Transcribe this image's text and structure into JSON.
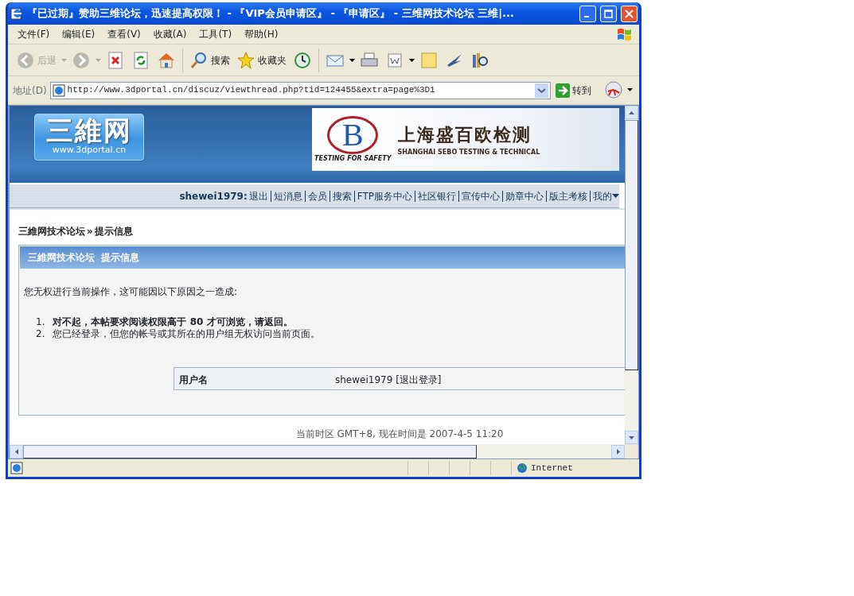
{
  "window": {
    "title": "『已过期』赞助三维论坛，迅速提高权限！ - 『VIP会员申请区』 - 『申请区』 - 三维网技术论坛 三维|..."
  },
  "menu": [
    "文件(F)",
    "编辑(E)",
    "查看(V)",
    "收藏(A)",
    "工具(T)",
    "帮助(H)"
  ],
  "toolbar": [
    {
      "kind": "back",
      "label": "后退",
      "disabled": true,
      "dropdown": true
    },
    {
      "kind": "forward",
      "disabled": true,
      "dropdown": true
    },
    {
      "kind": "stop"
    },
    {
      "kind": "refresh"
    },
    {
      "kind": "home"
    },
    {
      "kind": "search",
      "label": "搜索"
    },
    {
      "kind": "favorites",
      "label": "收藏夹"
    },
    {
      "kind": "history"
    },
    {
      "kind": "mail",
      "dropdown": true
    },
    {
      "kind": "print"
    },
    {
      "kind": "edit",
      "dropdown": true
    },
    {
      "kind": "note"
    },
    {
      "kind": "messenger"
    },
    {
      "kind": "research"
    }
  ],
  "address": {
    "label": "地址(D)",
    "url": "http://www.3dportal.cn/discuz/viewthread.php?tid=124455&extra=page%3D1",
    "go": "转到"
  },
  "page": {
    "logo": {
      "title": "三維网",
      "subtitle": "www.3dportal.cn"
    },
    "banner": {
      "letter": "B",
      "tagline": "TESTING FOR SAFETY",
      "title": "上海盛百欧检测",
      "subtitle": "SHANGHAI SEBO TESTING & TECHNICAL"
    },
    "user_nav": {
      "username": "shewei1979:",
      "links": [
        "退出",
        "短消息",
        "会员",
        "搜索",
        "FTP服务中心",
        "社区银行",
        "宣传中心",
        "勋章中心",
        "版主考核",
        "我的"
      ]
    },
    "breadcrumb": [
      "三維网技术论坛",
      "»",
      "提示信息"
    ],
    "panel": {
      "header": "三維网技术论坛  提示信息",
      "message": "您无权进行当前操作，这可能因以下原因之一造成:",
      "reasons": [
        {
          "number": "1.",
          "text": "对不起，本帖要求阅读权限高于 80 才可浏览，请返回。",
          "emphasis": true
        },
        {
          "number": "2.",
          "text": "您已经登录，但您的帐号或其所在的用户组无权访问当前页面。",
          "emphasis": false
        }
      ],
      "info": {
        "label": "用户名",
        "value": "shewei1979 [退出登录]"
      }
    },
    "footer": "当前时区 GMT+8, 现在时间是 2007-4-5 11:20"
  },
  "status_bar": {
    "zone": "Internet"
  }
}
